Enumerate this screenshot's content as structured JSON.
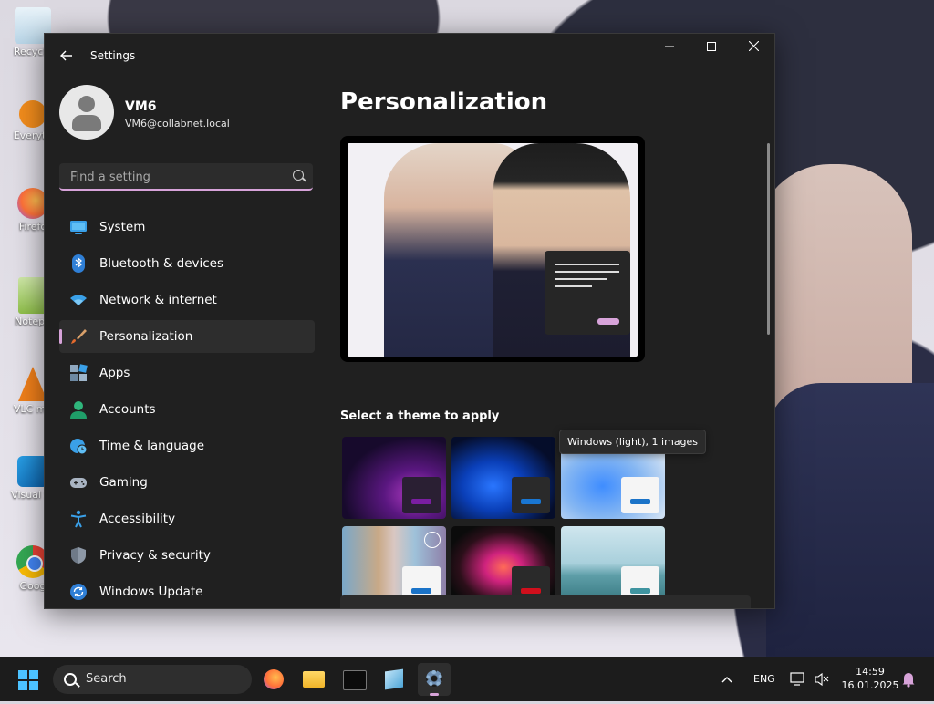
{
  "desktop": {
    "icons": [
      {
        "label": "Recycle"
      },
      {
        "label": "Everyth"
      },
      {
        "label": "Firefo"
      },
      {
        "label": "Notepa"
      },
      {
        "label": "VLC me"
      },
      {
        "label": "Visual St"
      },
      {
        "label": "Goog"
      }
    ]
  },
  "settings": {
    "title": "Settings",
    "user": {
      "name": "VM6",
      "email": "VM6@collabnet.local"
    },
    "search": {
      "placeholder": "Find a setting"
    },
    "nav": [
      {
        "label": "System",
        "icon": "monitor-icon"
      },
      {
        "label": "Bluetooth & devices",
        "icon": "bluetooth-icon"
      },
      {
        "label": "Network & internet",
        "icon": "wifi-icon"
      },
      {
        "label": "Personalization",
        "icon": "paintbrush-icon",
        "active": true
      },
      {
        "label": "Apps",
        "icon": "apps-icon"
      },
      {
        "label": "Accounts",
        "icon": "person-icon"
      },
      {
        "label": "Time & language",
        "icon": "globe-clock-icon"
      },
      {
        "label": "Gaming",
        "icon": "gamepad-icon"
      },
      {
        "label": "Accessibility",
        "icon": "accessibility-icon"
      },
      {
        "label": "Privacy & security",
        "icon": "shield-icon"
      },
      {
        "label": "Windows Update",
        "icon": "update-icon"
      }
    ],
    "page_title": "Personalization",
    "themes_label": "Select a theme to apply",
    "tooltip": "Windows (light), 1 images",
    "colors": {
      "accent": "#d7a3d9",
      "window": "#202020",
      "taskbar": "#1c1c1c"
    }
  },
  "taskbar": {
    "search_label": "Search",
    "language": "ENG",
    "time": "14:59",
    "date": "16.01.2025"
  }
}
